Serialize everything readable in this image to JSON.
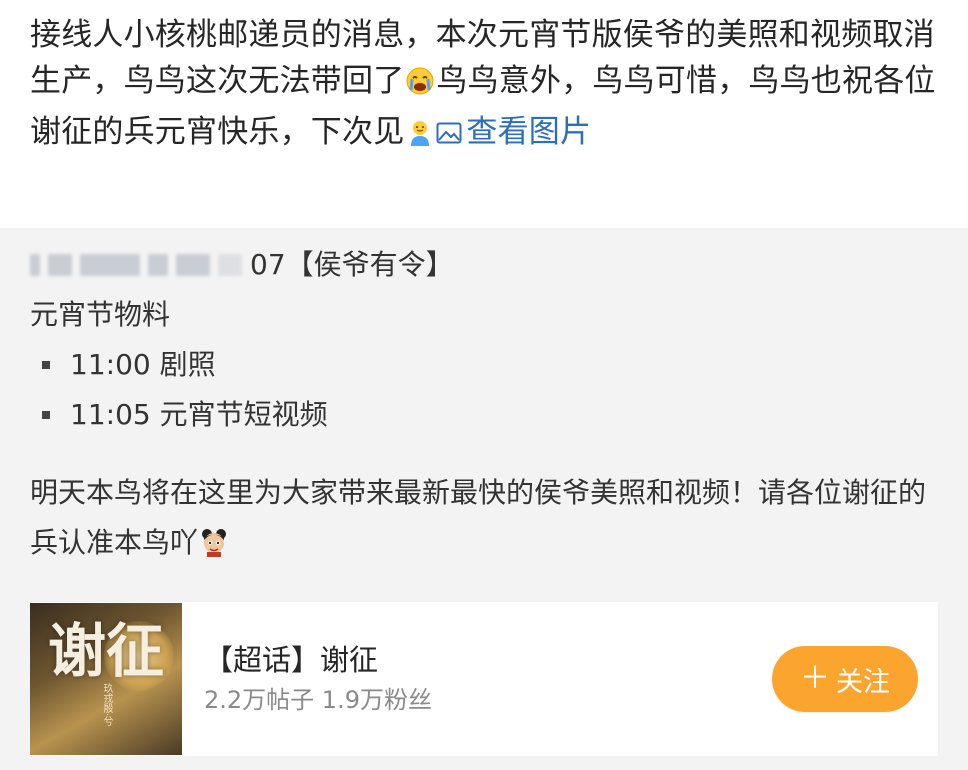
{
  "post": {
    "segment_1": "接线人小核桃邮递员的消息，本次元宵节版侯爷的美照和视频取消生产，鸟鸟这次无法带回了",
    "segment_2": "鸟鸟意外，鸟鸟可惜，鸟鸟也祝各位谢征的兵元宵快乐，下次见",
    "view_image_label": "查看图片",
    "emoji_1": "crying-face-emoji",
    "emoji_2": "waving-person-emoji"
  },
  "quote": {
    "handle_suffix": "07",
    "tag": "【侯爷有令】",
    "heading": "元宵节物料",
    "schedule": [
      {
        "label": "11:00 剧照"
      },
      {
        "label": "11:05 元宵节短视频"
      }
    ],
    "body": "明天本鸟将在这里为大家带来最新最快的侯爷美照和视频！请各位谢征的兵认准本鸟吖",
    "mascot_emoji": "cartoon-boy-emoji"
  },
  "topic_card": {
    "title": "【超话】谢征",
    "meta": "2.2万帖子 1.9万粉丝",
    "follow_label": "关注",
    "follow_icon": "plus",
    "cover_text": "谢征",
    "cover_subtext": "玖戎殷·兮",
    "accent_color": "#fca52e"
  },
  "colors": {
    "link": "#2e6eb6",
    "quote_bg": "#f3f3f3",
    "text": "#262626",
    "meta": "#8a8a8a"
  }
}
